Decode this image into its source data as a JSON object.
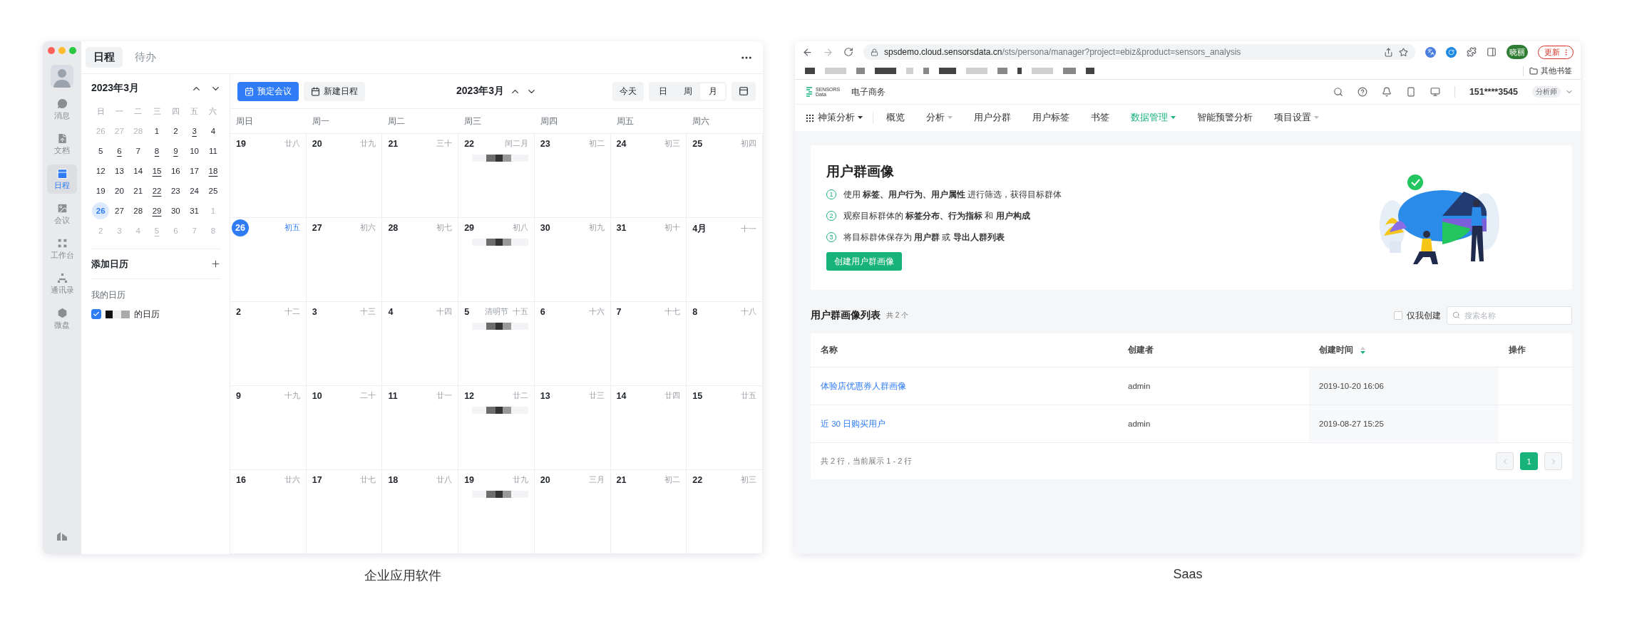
{
  "left_app": {
    "sidebar": [
      {
        "label": "消息",
        "selected": false
      },
      {
        "label": "文档",
        "selected": false
      },
      {
        "label": "日程",
        "selected": true
      },
      {
        "label": "会议",
        "selected": false
      },
      {
        "label": "工作台",
        "selected": false
      },
      {
        "label": "通讯录",
        "selected": false
      },
      {
        "label": "微盘",
        "selected": false
      }
    ],
    "tabs": [
      {
        "label": "日程",
        "selected": true
      },
      {
        "label": "待办",
        "selected": false
      }
    ],
    "mini_calendar": {
      "title": "2023年3月",
      "weekdays": [
        "日",
        "一",
        "二",
        "三",
        "四",
        "五",
        "六"
      ],
      "weeks": [
        [
          {
            "d": "26",
            "muted": true,
            "marked": false,
            "today": false
          },
          {
            "d": "27",
            "muted": true,
            "marked": false,
            "today": false
          },
          {
            "d": "28",
            "muted": true,
            "marked": false,
            "today": false
          },
          {
            "d": "1",
            "muted": false,
            "marked": false,
            "today": false
          },
          {
            "d": "2",
            "muted": false,
            "marked": false,
            "today": false
          },
          {
            "d": "3",
            "muted": false,
            "marked": true,
            "today": false
          },
          {
            "d": "4",
            "muted": false,
            "marked": false,
            "today": false
          }
        ],
        [
          {
            "d": "5",
            "muted": false,
            "marked": false,
            "today": false
          },
          {
            "d": "6",
            "muted": false,
            "marked": true,
            "today": false
          },
          {
            "d": "7",
            "muted": false,
            "marked": false,
            "today": false
          },
          {
            "d": "8",
            "muted": false,
            "marked": true,
            "today": false
          },
          {
            "d": "9",
            "muted": false,
            "marked": true,
            "today": false
          },
          {
            "d": "10",
            "muted": false,
            "marked": false,
            "today": false
          },
          {
            "d": "11",
            "muted": false,
            "marked": false,
            "today": false
          }
        ],
        [
          {
            "d": "12",
            "muted": false,
            "marked": false,
            "today": false
          },
          {
            "d": "13",
            "muted": false,
            "marked": false,
            "today": false
          },
          {
            "d": "14",
            "muted": false,
            "marked": false,
            "today": false
          },
          {
            "d": "15",
            "muted": false,
            "marked": true,
            "today": false
          },
          {
            "d": "16",
            "muted": false,
            "marked": false,
            "today": false
          },
          {
            "d": "17",
            "muted": false,
            "marked": false,
            "today": false
          },
          {
            "d": "18",
            "muted": false,
            "marked": true,
            "today": false
          }
        ],
        [
          {
            "d": "19",
            "muted": false,
            "marked": false,
            "today": false
          },
          {
            "d": "20",
            "muted": false,
            "marked": false,
            "today": false
          },
          {
            "d": "21",
            "muted": false,
            "marked": false,
            "today": false
          },
          {
            "d": "22",
            "muted": false,
            "marked": true,
            "today": false
          },
          {
            "d": "23",
            "muted": false,
            "marked": false,
            "today": false
          },
          {
            "d": "24",
            "muted": false,
            "marked": false,
            "today": false
          },
          {
            "d": "25",
            "muted": false,
            "marked": false,
            "today": false
          }
        ],
        [
          {
            "d": "26",
            "muted": false,
            "marked": false,
            "today": true
          },
          {
            "d": "27",
            "muted": false,
            "marked": false,
            "today": false
          },
          {
            "d": "28",
            "muted": false,
            "marked": false,
            "today": false
          },
          {
            "d": "29",
            "muted": false,
            "marked": true,
            "today": false
          },
          {
            "d": "30",
            "muted": false,
            "marked": false,
            "today": false
          },
          {
            "d": "31",
            "muted": false,
            "marked": false,
            "today": false
          },
          {
            "d": "1",
            "muted": true,
            "marked": false,
            "today": false
          }
        ],
        [
          {
            "d": "2",
            "muted": true,
            "marked": false,
            "today": false
          },
          {
            "d": "3",
            "muted": true,
            "marked": false,
            "today": false
          },
          {
            "d": "4",
            "muted": true,
            "marked": false,
            "today": false
          },
          {
            "d": "5",
            "muted": true,
            "marked": true,
            "today": false
          },
          {
            "d": "6",
            "muted": true,
            "marked": false,
            "today": false
          },
          {
            "d": "7",
            "muted": true,
            "marked": false,
            "today": false
          },
          {
            "d": "8",
            "muted": true,
            "marked": false,
            "today": false
          }
        ]
      ]
    },
    "add_calendar": "添加日历",
    "my_calendars": {
      "title": "我的日历",
      "items": [
        {
          "label": "的日历",
          "checked": true
        }
      ]
    },
    "toolbar": {
      "book_meeting": "预定会议",
      "new_event": "新建日程",
      "month_title": "2023年3月",
      "today": "今天",
      "views": [
        {
          "label": "日",
          "selected": false
        },
        {
          "label": "周",
          "selected": false
        },
        {
          "label": "月",
          "selected": true
        }
      ]
    },
    "weekdays": [
      "周日",
      "周一",
      "周二",
      "周三",
      "周四",
      "周五",
      "周六"
    ],
    "weeks": [
      [
        {
          "date": "19",
          "lunar": "廿八",
          "today": false,
          "event": false
        },
        {
          "date": "20",
          "lunar": "廿九",
          "today": false,
          "event": false
        },
        {
          "date": "21",
          "lunar": "三十",
          "today": false,
          "event": false
        },
        {
          "date": "22",
          "lunar": "闰二月",
          "today": false,
          "event": true
        },
        {
          "date": "23",
          "lunar": "初二",
          "today": false,
          "event": false
        },
        {
          "date": "24",
          "lunar": "初三",
          "today": false,
          "event": false
        },
        {
          "date": "25",
          "lunar": "初四",
          "today": false,
          "event": false
        }
      ],
      [
        {
          "date": "26",
          "lunar": "初五",
          "today": true,
          "event": false
        },
        {
          "date": "27",
          "lunar": "初六",
          "today": false,
          "event": false
        },
        {
          "date": "28",
          "lunar": "初七",
          "today": false,
          "event": false
        },
        {
          "date": "29",
          "lunar": "初八",
          "today": false,
          "event": true
        },
        {
          "date": "30",
          "lunar": "初九",
          "today": false,
          "event": false
        },
        {
          "date": "31",
          "lunar": "初十",
          "today": false,
          "event": false
        },
        {
          "date": "4月",
          "lunar": "十一",
          "today": false,
          "event": false
        }
      ],
      [
        {
          "date": "2",
          "lunar": "十二",
          "today": false,
          "event": false
        },
        {
          "date": "3",
          "lunar": "十三",
          "today": false,
          "event": false
        },
        {
          "date": "4",
          "lunar": "十四",
          "today": false,
          "event": false
        },
        {
          "date": "5",
          "holiday": "清明节",
          "lunar": "十五",
          "today": false,
          "event": true
        },
        {
          "date": "6",
          "lunar": "十六",
          "today": false,
          "event": false
        },
        {
          "date": "7",
          "lunar": "十七",
          "today": false,
          "event": false
        },
        {
          "date": "8",
          "lunar": "十八",
          "today": false,
          "event": false
        }
      ],
      [
        {
          "date": "9",
          "lunar": "十九",
          "today": false,
          "event": false
        },
        {
          "date": "10",
          "lunar": "二十",
          "today": false,
          "event": false
        },
        {
          "date": "11",
          "lunar": "廿一",
          "today": false,
          "event": false
        },
        {
          "date": "12",
          "lunar": "廿二",
          "today": false,
          "event": true
        },
        {
          "date": "13",
          "lunar": "廿三",
          "today": false,
          "event": false
        },
        {
          "date": "14",
          "lunar": "廿四",
          "today": false,
          "event": false
        },
        {
          "date": "15",
          "lunar": "廿五",
          "today": false,
          "event": false
        }
      ],
      [
        {
          "date": "16",
          "lunar": "廿六",
          "today": false,
          "event": false
        },
        {
          "date": "17",
          "lunar": "廿七",
          "today": false,
          "event": false
        },
        {
          "date": "18",
          "lunar": "廿八",
          "today": false,
          "event": false
        },
        {
          "date": "19",
          "lunar": "廿九",
          "today": false,
          "event": true
        },
        {
          "date": "20",
          "lunar": "三月",
          "today": false,
          "event": false
        },
        {
          "date": "21",
          "lunar": "初二",
          "today": false,
          "event": false
        },
        {
          "date": "22",
          "lunar": "初三",
          "today": false,
          "event": false
        }
      ]
    ],
    "caption": "企业应用软件"
  },
  "saas_app": {
    "browser": {
      "url_host": "spsdemo.cloud.sensorsdata.cn",
      "url_path": "/sts/persona/manager?project=ebiz&product=sensors_analysis",
      "profile": "晓丽",
      "update_button": "更新",
      "bookmarks_folder": "其他书签"
    },
    "header": {
      "logo_top": "SENSORS",
      "logo_bottom": "Data",
      "project": "电子商务",
      "account": "151****3545",
      "role": "分析师"
    },
    "nav": [
      {
        "label": "神策分析",
        "kind": "product",
        "selected": false,
        "dropdown": true
      },
      {
        "label": "概览",
        "kind": "link",
        "selected": false,
        "dropdown": false
      },
      {
        "label": "分析",
        "kind": "link",
        "selected": false,
        "dropdown": true
      },
      {
        "label": "用户分群",
        "kind": "link",
        "selected": false,
        "dropdown": false
      },
      {
        "label": "用户标签",
        "kind": "link",
        "selected": false,
        "dropdown": false
      },
      {
        "label": "书签",
        "kind": "link",
        "selected": false,
        "dropdown": false
      },
      {
        "label": "数据管理",
        "kind": "link",
        "selected": true,
        "dropdown": true
      },
      {
        "label": "智能预警分析",
        "kind": "link",
        "selected": false,
        "dropdown": false
      },
      {
        "label": "项目设置",
        "kind": "link",
        "selected": false,
        "dropdown": true
      }
    ],
    "intro": {
      "title": "用户群画像",
      "steps": [
        {
          "number": "1",
          "text": "使用 **标签、用户行为、用户属性** 进行筛选，获得目标群体"
        },
        {
          "number": "2",
          "text": "观察目标群体的 **标签分布、行为指标** 和 **用户构成**"
        },
        {
          "number": "3",
          "text": "将目标群体保存为 **用户群** 或 **导出人群列表**"
        }
      ],
      "button": "创建用户群画像"
    },
    "list": {
      "title": "用户群画像列表",
      "count": "共 2 个",
      "only_mine": {
        "label": "仅我创建",
        "checked": false
      },
      "search": {
        "placeholder": "搜索名称"
      },
      "columns": [
        "名称",
        "创建者",
        "创建时间",
        "操作"
      ],
      "rows": [
        [
          "体验店优惠券人群画像",
          "admin",
          "2019-10-20 16:06"
        ],
        [
          "近 30 日购买用户",
          "admin",
          "2019-08-27 15:25"
        ]
      ],
      "footer": "共 2 行，当前展示 1 - 2 行",
      "pages": [
        {
          "label": "1",
          "selected": true
        }
      ]
    },
    "caption": "Saas"
  }
}
